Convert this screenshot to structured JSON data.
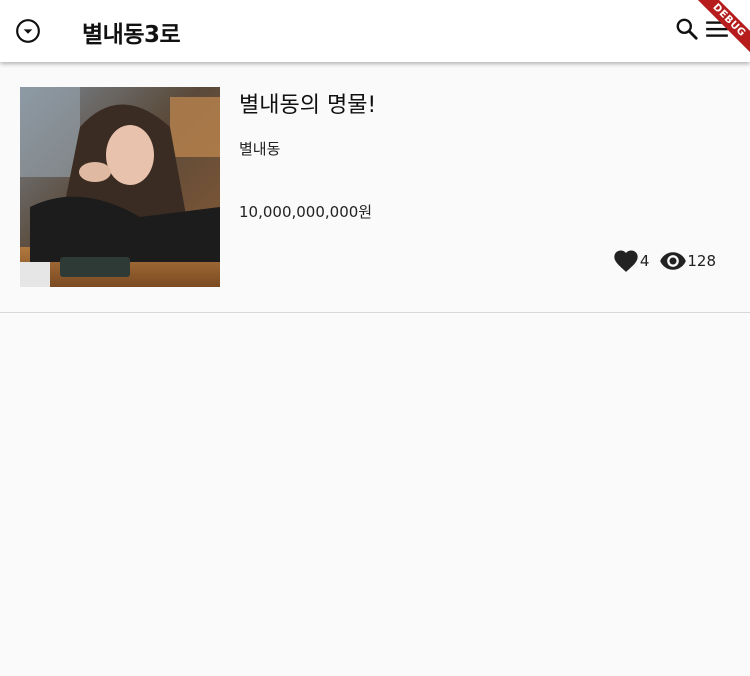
{
  "appbar": {
    "location_title": "별내동3로",
    "left_icon": "arrow-drop-down-circle-icon",
    "search_icon": "search-icon",
    "menu_icon": "menu-icon"
  },
  "debug_banner": {
    "label": "DEBUG",
    "color": "#b71c1c"
  },
  "listings": [
    {
      "title": "별내동의 명물!",
      "location": "별내동",
      "price": "10,000,000,000원",
      "likes": "4",
      "views": "128",
      "like_icon": "heart-icon",
      "view_icon": "eye-icon"
    }
  ]
}
